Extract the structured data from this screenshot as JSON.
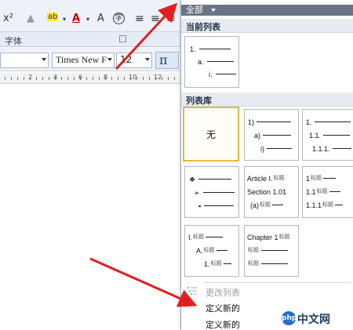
{
  "ribbon": {
    "superscript_label": "x²",
    "font_group_label": "字体",
    "font_name_value": "Times New F",
    "font_size_value": "12",
    "equation_label": "π"
  },
  "ruler": {
    "numbers": [
      "2",
      "4",
      "6",
      "8",
      "10",
      "12"
    ]
  },
  "panel": {
    "scope_label": "全部",
    "current_list_header": "当前列表",
    "library_header": "列表库",
    "none_label": "无",
    "current_list": [
      "1.",
      "a.",
      "i."
    ],
    "tile_1ai": [
      "1)",
      "a)",
      "i)"
    ],
    "tile_num": [
      "1.",
      "1.1.",
      "1.1.1."
    ],
    "tile_bullets": [
      "❖",
      "➢",
      "▪"
    ],
    "tile_article": {
      "r1": "Article I.",
      "r1_tag": "标题",
      "r2": "Section 1.01",
      "r3": "(a)",
      "r3_tag": "标题"
    },
    "tile_heading_num": {
      "r1": "1",
      "r1_tag": "标题",
      "r2": "1.1",
      "r2_tag": "标题",
      "r3": "1.1.1",
      "r3_tag": "标题"
    },
    "tile_roman": {
      "r1": "I.",
      "r1_tag": "标题",
      "r2": "A.",
      "r2_tag": "标题",
      "r3": "1.",
      "r3_tag": "标题"
    },
    "tile_chapter": {
      "r1": "Chapter 1",
      "r1_tag": "标题",
      "r2_tag": "标题",
      "r3_tag": "标题"
    },
    "menu": {
      "change_level": "更改列表",
      "define_new_1": "定义新的",
      "define_new_2": "定义新的"
    }
  },
  "watermark": {
    "logo": "php",
    "text": "中文网"
  },
  "colors": {
    "arrow": "#e02020",
    "selected_tile_border": "#e5b84a",
    "scope_bar": "#6b7385"
  }
}
